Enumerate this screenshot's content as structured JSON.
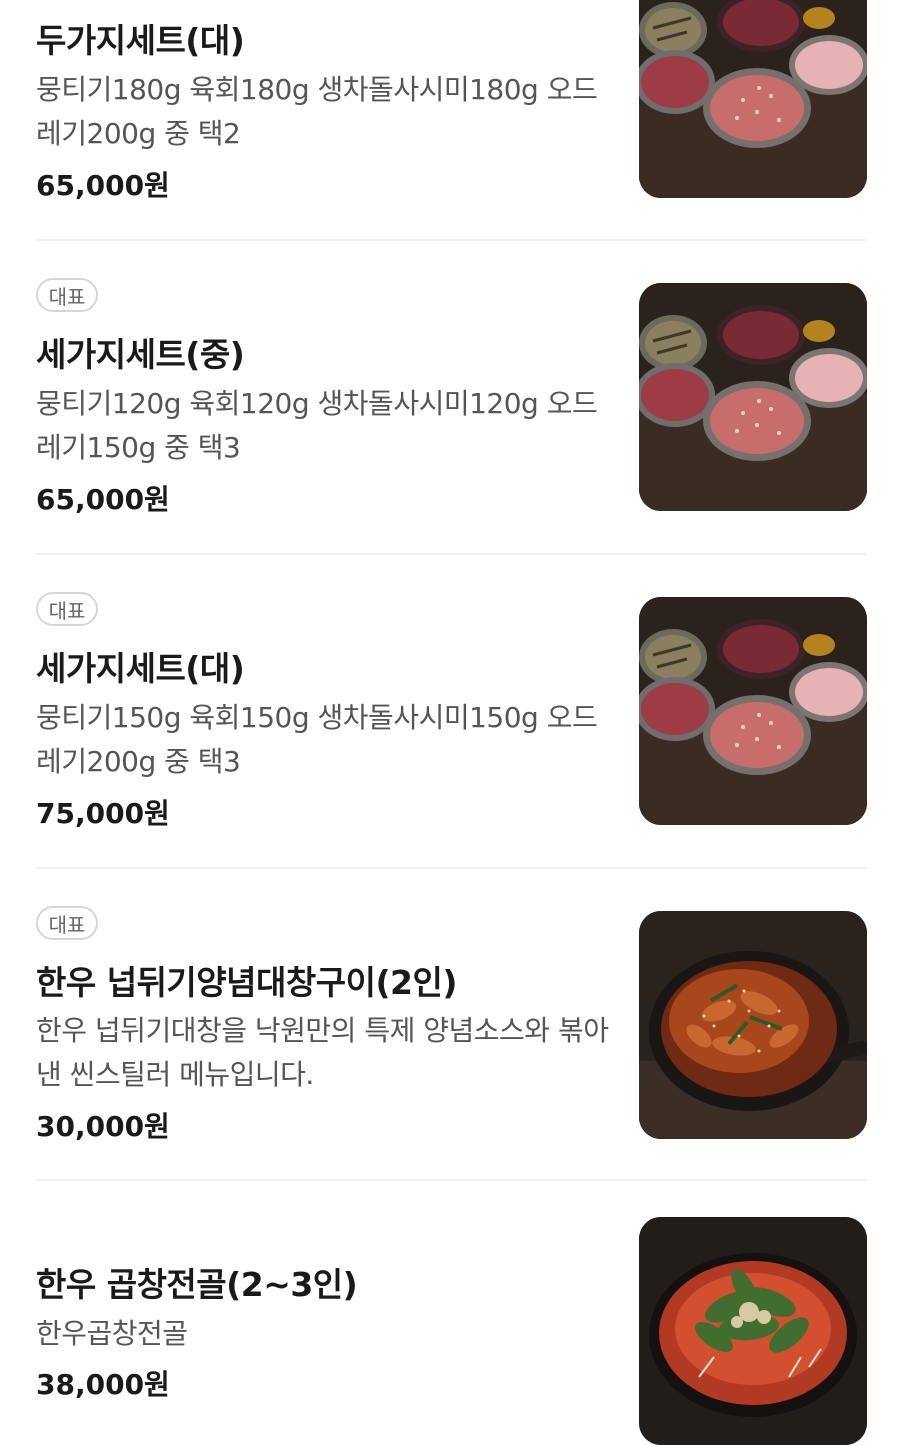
{
  "items": [
    {
      "name": "두가지세트(대)",
      "badge": "",
      "desc": "뭉티기180g 육회180g 생차돌사시미180g 오드레기200g 중 택2",
      "price": "65,000원",
      "image": "meat-platter-image"
    },
    {
      "name": "세가지세트(중)",
      "badge": "대표",
      "desc": "뭉티기120g 육회120g 생차돌사시미120g 오드레기150g 중 택3",
      "price": "65,000원",
      "image": "meat-platter-image"
    },
    {
      "name": "세가지세트(대)",
      "badge": "대표",
      "desc": "뭉티기150g 육회150g 생차돌사시미150g 오드레기200g 중 택3",
      "price": "75,000원",
      "image": "meat-platter-image"
    },
    {
      "name": "한우 넙뒤기양념대창구이(2인)",
      "badge": "대표",
      "desc": "한우 넙뒤기대창을 낙원만의 특제 양념소스와 볶아낸 씬스틸러 메뉴입니다.",
      "price": "30,000원",
      "image": "grilled-tripe-pan-image"
    },
    {
      "name": "한우 곱창전골(2~3인)",
      "badge": "",
      "desc": "한우곱창전골",
      "price": "38,000원",
      "image": "tripe-hotpot-image"
    }
  ]
}
